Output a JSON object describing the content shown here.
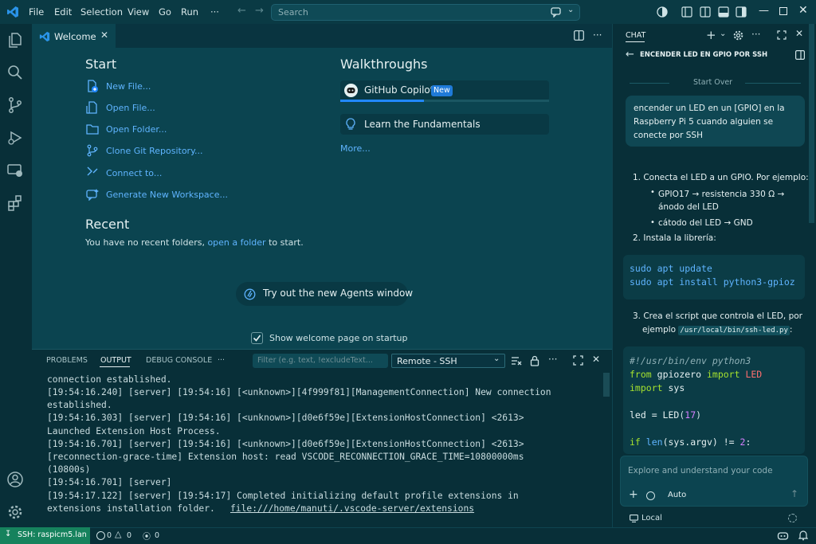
{
  "menu": [
    "File",
    "Edit",
    "Selection",
    "View",
    "Go",
    "Run",
    "···"
  ],
  "search": {
    "placeholder": "Search"
  },
  "editor": {
    "tab_label": "Welcome",
    "start_heading": "Start",
    "start_items": [
      "New File...",
      "Open File...",
      "Open Folder...",
      "Clone Git Repository...",
      "Connect to...",
      "Generate New Workspace..."
    ],
    "recent_heading": "Recent",
    "recent_text_before": "You have no recent folders,",
    "recent_link": "open a folder",
    "recent_text_after": "to start.",
    "walkthroughs_heading": "Walkthroughs",
    "walkthroughs": [
      {
        "label": "GitHub Copilot",
        "badge": "New",
        "progress": 0.4
      },
      {
        "label": "Learn the Fundamentals"
      }
    ],
    "more_link": "More...",
    "agents_button": "Try out the new Agents window",
    "show_welcome_label": "Show welcome page on startup",
    "show_welcome_checked": true
  },
  "panel": {
    "tabs": [
      "PROBLEMS",
      "OUTPUT",
      "DEBUG CONSOLE",
      "···"
    ],
    "active_tab": "OUTPUT",
    "filter_placeholder": "Filter (e.g. text, !excludeText...",
    "channel": "Remote - SSH",
    "log_lines": [
      "connection established.",
      "[19:54:16.240] [server] [19:54:16] [<unknown>][4f999f81][ManagementConnection] New connection",
      "established.",
      "[19:54:16.303] [server] [19:54:16] [<unknown>][d0e6f59e][ExtensionHostConnection] <2613>",
      "Launched Extension Host Process.",
      "[19:54:16.701] [server] [19:54:16] [<unknown>][d0e6f59e][ExtensionHostConnection] <2613>",
      "[reconnection-grace-time] Extension host: read VSCODE_RECONNECTION_GRACE_TIME=10800000ms",
      "(10800s)",
      "[19:54:16.701] [server]",
      "[19:54:17.122] [server] [19:54:17] Completed initializing default profile extensions in",
      "extensions installation folder."
    ],
    "log_link": "file:///home/manuti/.vscode-server/extensions"
  },
  "chat": {
    "header": "CHAT",
    "title": "ENCENDER LED EN GPIO POR SSH",
    "start_over": "Start Over",
    "user_message": "encender un LED en un [GPIO] en la Raspberry Pi 5 cuando alguien se conecte por SSH",
    "step1": "1. Conecta el LED a un GPIO. Por ejemplo:",
    "step1_a": "GPIO17 → resistencia 330 Ω → ánodo del LED",
    "step1_b": "cátodo del LED → GND",
    "step2": "2. Instala la librería:",
    "code1": [
      "sudo apt update",
      "sudo apt install python3-gpioz"
    ],
    "step3_a": "3. Crea el script que controla el LED, por",
    "step3_b": "ejemplo",
    "step3_path": "/usr/local/bin/ssh-led.py",
    "step3_end": ":",
    "code2": {
      "shebang": "#!/usr/bin/env python3",
      "from": "from",
      "module": "gpiozero",
      "import": "import",
      "cls": "LED",
      "import2": "import",
      "sys": "sys",
      "led_var": "led = ",
      "led_call": "LED",
      "led_arg": "17",
      "if_kw": "if",
      "len_fn": "len",
      "if_rest": "(sys.argv) != ",
      "if_num": "2",
      "if_colon": ":"
    },
    "input_placeholder": "Explore and understand your code",
    "mode": "Auto",
    "location": "Local"
  },
  "status": {
    "remote": "SSH: raspicm5.lan",
    "errors": "0",
    "warnings": "0",
    "ports": "0"
  },
  "colors": {
    "accent": "#2188ff",
    "link": "#5fb4ff",
    "remote_bg": "#16825d",
    "keyword": "#ff6e6e",
    "string_green": "#a6e22e",
    "code_blue": "#5fb4ff"
  }
}
